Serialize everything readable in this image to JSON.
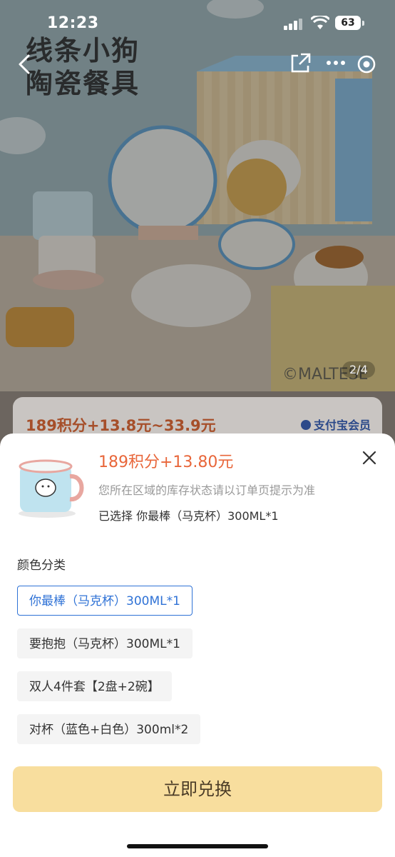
{
  "status_bar": {
    "time": "12:23",
    "battery": "63"
  },
  "hero": {
    "title_line1": "线条小狗",
    "title_line2": "陶瓷餐具",
    "watermark": "©MALTESE",
    "pager": "2/4",
    "price_range": "189积分+13.8元~33.9元",
    "member_badge": "支付宝会员"
  },
  "sheet": {
    "price": "189积分+13.80元",
    "stock_note": "您所在区域的库存状态请以订单页提示为准",
    "selected_text": "已选择  你最棒（马克杯）300ML*1",
    "section_label": "颜色分类",
    "options": [
      {
        "label": "你最棒（马克杯）300ML*1",
        "selected": true
      },
      {
        "label": "要抱抱（马克杯）300ML*1",
        "selected": false
      },
      {
        "label": "双人4件套【2盘+2碗】",
        "selected": false
      },
      {
        "label": "对杯（蓝色+白色）300ml*2",
        "selected": false
      }
    ],
    "cta_label": "立即兑换"
  },
  "colors": {
    "accent_blue": "#2f72d6",
    "price_orange": "#e8663a",
    "cta_bg": "#f8de9e"
  }
}
